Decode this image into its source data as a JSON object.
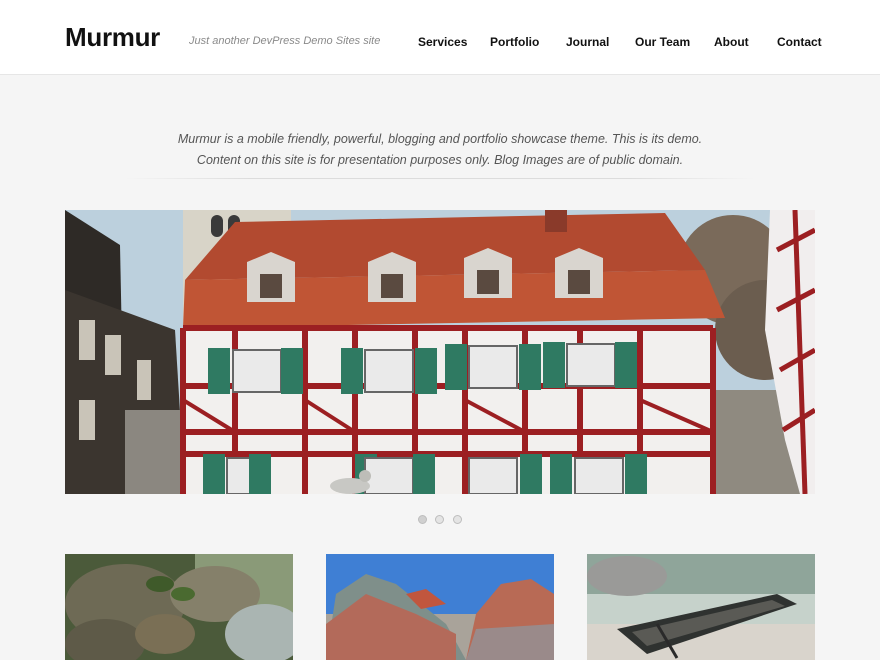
{
  "site": {
    "title": "Murmur",
    "tagline": "Just another DevPress Demo Sites site"
  },
  "nav": {
    "items": [
      {
        "label": "Services"
      },
      {
        "label": "Portfolio"
      },
      {
        "label": "Journal"
      },
      {
        "label": "Our Team"
      },
      {
        "label": "About"
      },
      {
        "label": "Contact"
      }
    ]
  },
  "intro": {
    "text": "Murmur is a mobile friendly, powerful, blogging and portfolio showcase theme. This is its demo. Content on this site is for presentation purposes only. Blog Images are of public domain."
  },
  "slider": {
    "slide_count": 3,
    "active_index": 0,
    "image_icon": "half-timbered-house-photo"
  },
  "thumbnails": [
    {
      "image_icon": "frogs-on-rocks-photo"
    },
    {
      "image_icon": "painted-desert-hills-photo"
    },
    {
      "image_icon": "rowboat-on-shore-photo"
    }
  ],
  "colors": {
    "background": "#f5f5f5",
    "header_bg": "#ffffff",
    "text": "#111111",
    "muted": "#8a8a8a"
  }
}
